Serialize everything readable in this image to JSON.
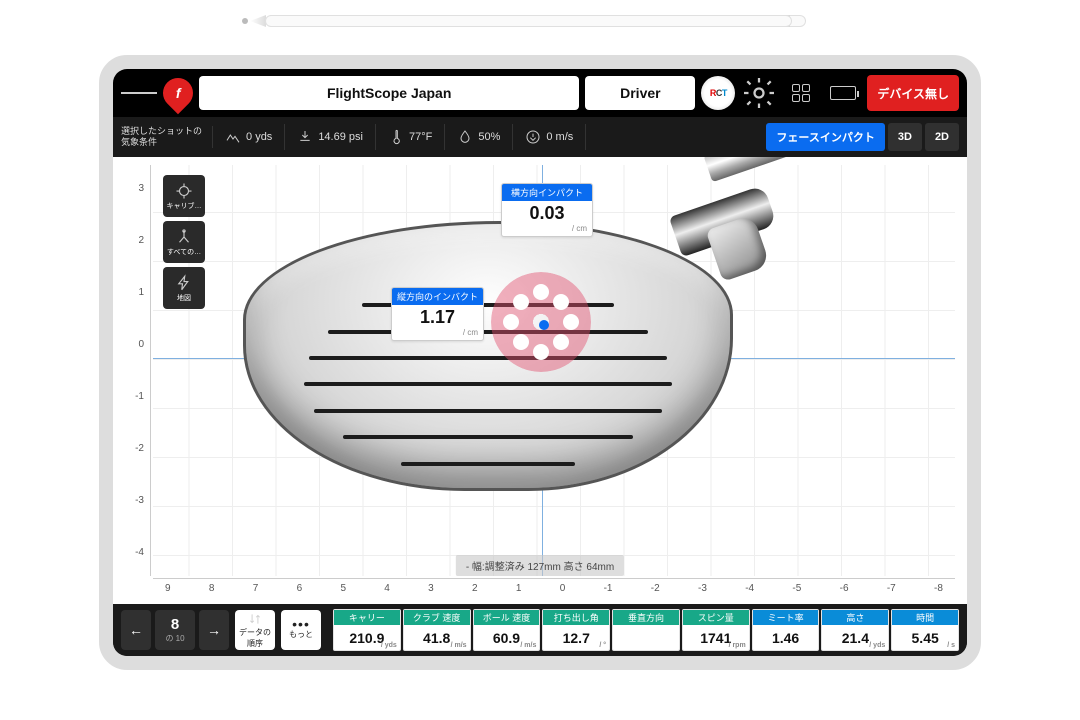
{
  "topbar": {
    "title": "FlightScope Japan",
    "club": "Driver",
    "device_status": "デバイス無し"
  },
  "conditions": {
    "label": "選択したショットの\n気象条件",
    "altitude": "0 yds",
    "pressure": "14.69 psi",
    "temperature": "77°F",
    "humidity": "50%",
    "wind": "0 m/s"
  },
  "view_tabs": {
    "face": "フェースインパクト",
    "threeD": "3D",
    "twoD": "2D"
  },
  "tools": {
    "calibrate": "キャリブ…",
    "all": "すべての…",
    "map": "地図"
  },
  "impact": {
    "horizontal_label": "横方向インパクト",
    "horizontal_value": "0.03",
    "horizontal_unit": "/ cm",
    "vertical_label": "縦方向のインバクト",
    "vertical_value": "1.17",
    "vertical_unit": "/ cm"
  },
  "face_dims": "- 幅:調整済み 127mm 高さ 64mm",
  "yaxis": [
    "3",
    "2",
    "1",
    "0",
    "-1",
    "-2",
    "-3",
    "-4"
  ],
  "xaxis": [
    "9",
    "8",
    "7",
    "6",
    "5",
    "4",
    "3",
    "2",
    "1",
    "0",
    "-1",
    "-2",
    "-3",
    "-4",
    "-5",
    "-6",
    "-7",
    "-8"
  ],
  "nav": {
    "shot": "8",
    "of": "の 10",
    "sort_label": "データの\n順序",
    "more_label": "もっと"
  },
  "metrics": [
    {
      "label": "キャリー",
      "value": "210.9",
      "unit": "/ yds"
    },
    {
      "label": "クラブ 速度",
      "value": "41.8",
      "unit": "/ m/s"
    },
    {
      "label": "ボール 速度",
      "value": "60.9",
      "unit": "/ m/s"
    },
    {
      "label": "打ち出し角",
      "value": "12.7",
      "unit": "/ °"
    },
    {
      "label": "垂直方向",
      "value": "",
      "unit": ""
    },
    {
      "label": "スピン量",
      "value": "1741",
      "unit": "/ rpm"
    },
    {
      "label": "ミート率",
      "value": "1.46",
      "unit": ""
    },
    {
      "label": "高さ",
      "value": "21.4",
      "unit": "/ yds"
    },
    {
      "label": "時間",
      "value": "5.45",
      "unit": "/ s"
    }
  ]
}
